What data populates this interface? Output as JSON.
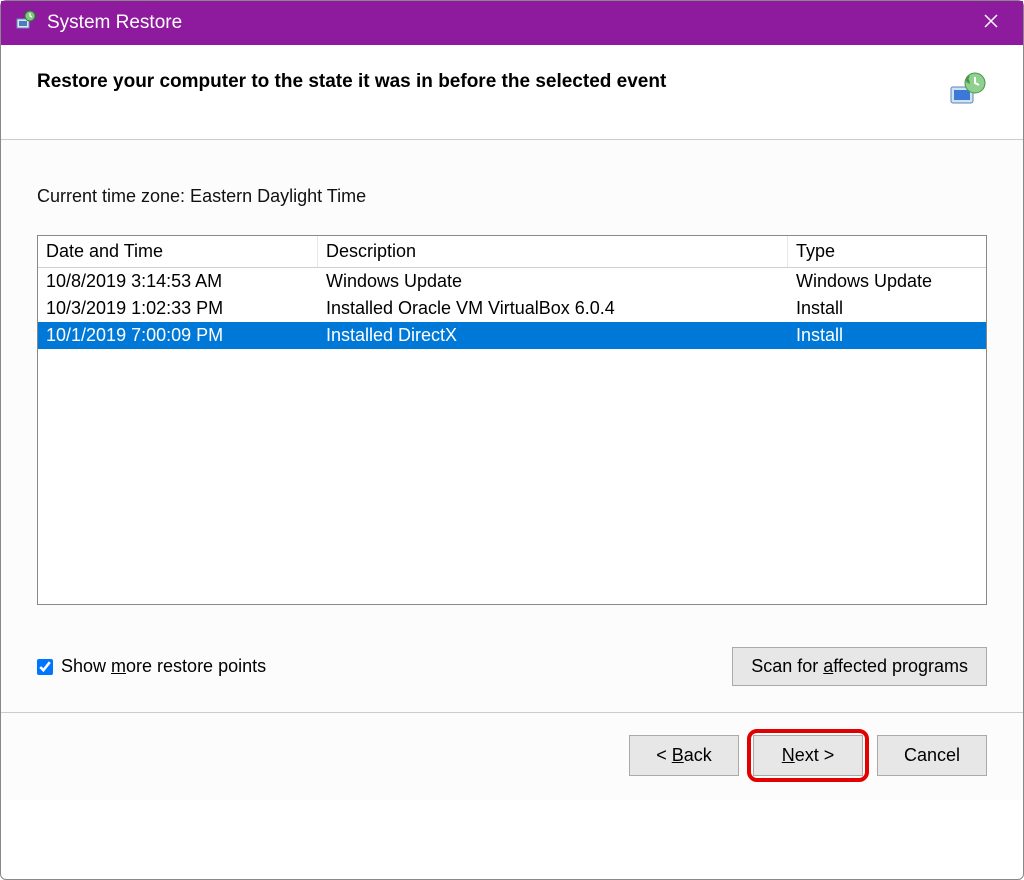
{
  "titlebar": {
    "title": "System Restore"
  },
  "header": {
    "text": "Restore your computer to the state it was in before the selected event"
  },
  "content": {
    "timezone_label": "Current time zone: Eastern Daylight Time",
    "columns": {
      "date": "Date and Time",
      "description": "Description",
      "type": "Type"
    },
    "rows": [
      {
        "date": "10/8/2019 3:14:53 AM",
        "description": "Windows Update",
        "type": "Windows Update",
        "selected": false
      },
      {
        "date": "10/3/2019 1:02:33 PM",
        "description": "Installed Oracle VM VirtualBox 6.0.4",
        "type": "Install",
        "selected": false
      },
      {
        "date": "10/1/2019 7:00:09 PM",
        "description": "Installed DirectX",
        "type": "Install",
        "selected": true
      }
    ],
    "show_more_checked": true,
    "show_more_prefix": "Show ",
    "show_more_underline": "m",
    "show_more_suffix": "ore restore points",
    "scan_prefix": "Scan for ",
    "scan_underline": "a",
    "scan_suffix": "ffected programs"
  },
  "footer": {
    "back_prefix": "< ",
    "back_underline": "B",
    "back_suffix": "ack",
    "next_underline": "N",
    "next_suffix": "ext >",
    "cancel": "Cancel"
  }
}
